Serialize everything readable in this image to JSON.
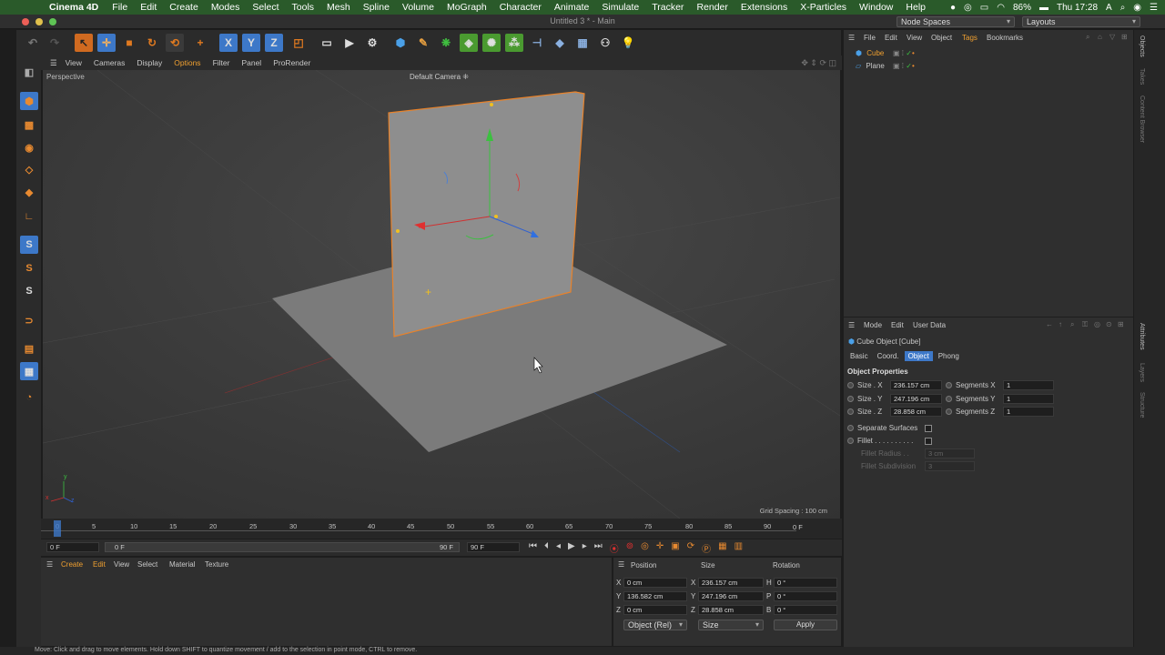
{
  "menubar": {
    "app": "Cinema 4D",
    "items": [
      "File",
      "Edit",
      "Create",
      "Modes",
      "Select",
      "Tools",
      "Mesh",
      "Spline",
      "Volume",
      "MoGraph",
      "Character",
      "Animate",
      "Simulate",
      "Tracker",
      "Render",
      "Extensions",
      "X-Particles",
      "Window",
      "Help"
    ],
    "battery": "86%",
    "clock": "Thu 17:28"
  },
  "window": {
    "title": "Untitled 3 * - Main",
    "node_spaces": "Node Spaces",
    "layouts": "Layouts"
  },
  "viewport": {
    "menu": [
      "View",
      "Cameras",
      "Display",
      "Options",
      "Filter",
      "Panel",
      "ProRender"
    ],
    "active_menu": "Options",
    "label": "Perspective",
    "camera": "Default Camera",
    "grid_spacing": "Grid Spacing : 100 cm"
  },
  "timeline": {
    "ticks": [
      "0",
      "5",
      "10",
      "15",
      "20",
      "25",
      "30",
      "35",
      "40",
      "45",
      "50",
      "55",
      "60",
      "65",
      "70",
      "75",
      "80",
      "85",
      "90"
    ],
    "current_frame": "0 F",
    "start": "0 F",
    "start2": "0 F",
    "end": "90 F",
    "end2": "90 F"
  },
  "material_manager": {
    "menu": [
      "Create",
      "Edit",
      "View",
      "Select",
      "Material",
      "Texture"
    ]
  },
  "coordinates": {
    "headers": [
      "Position",
      "Size",
      "Rotation"
    ],
    "rows": [
      {
        "axis": "X",
        "pos": "0 cm",
        "size_axis": "X",
        "size": "236.157 cm",
        "rot_axis": "H",
        "rot": "0 °"
      },
      {
        "axis": "Y",
        "pos": "136.582 cm",
        "size_axis": "Y",
        "size": "247.196 cm",
        "rot_axis": "P",
        "rot": "0 °"
      },
      {
        "axis": "Z",
        "pos": "0 cm",
        "size_axis": "Z",
        "size": "28.858 cm",
        "rot_axis": "B",
        "rot": "0 °"
      }
    ],
    "mode": "Object (Rel)",
    "size_mode": "Size",
    "apply": "Apply"
  },
  "object_manager": {
    "menu": [
      "File",
      "Edit",
      "View",
      "Object",
      "Tags",
      "Bookmarks"
    ],
    "objects": [
      "Cube",
      "Plane"
    ]
  },
  "attributes": {
    "menu": [
      "Mode",
      "Edit",
      "User Data"
    ],
    "object_title": "Cube Object [Cube]",
    "tabs": [
      "Basic",
      "Coord.",
      "Object",
      "Phong"
    ],
    "active_tab": "Object",
    "section": "Object Properties",
    "size": [
      {
        "label": "Size . X",
        "value": "236.157 cm",
        "seg_label": "Segments X",
        "seg": "1"
      },
      {
        "label": "Size . Y",
        "value": "247.196 cm",
        "seg_label": "Segments Y",
        "seg": "1"
      },
      {
        "label": "Size . Z",
        "value": "28.858 cm",
        "seg_label": "Segments Z",
        "seg": "1"
      }
    ],
    "separate_surfaces": "Separate Surfaces",
    "fillet": "Fillet . . . . . . . . . .",
    "fillet_radius": "Fillet Radius . .",
    "fillet_radius_val": "3 cm",
    "fillet_subdiv": "Fillet Subdivision",
    "fillet_subdiv_val": "3"
  },
  "side_tabs": [
    "Objects",
    "Takes",
    "Content Browser",
    "Attributes",
    "Layers",
    "Structure"
  ],
  "status": "Move: Click and drag to move elements. Hold down SHIFT to quantize movement / add to the selection in point mode, CTRL to remove."
}
